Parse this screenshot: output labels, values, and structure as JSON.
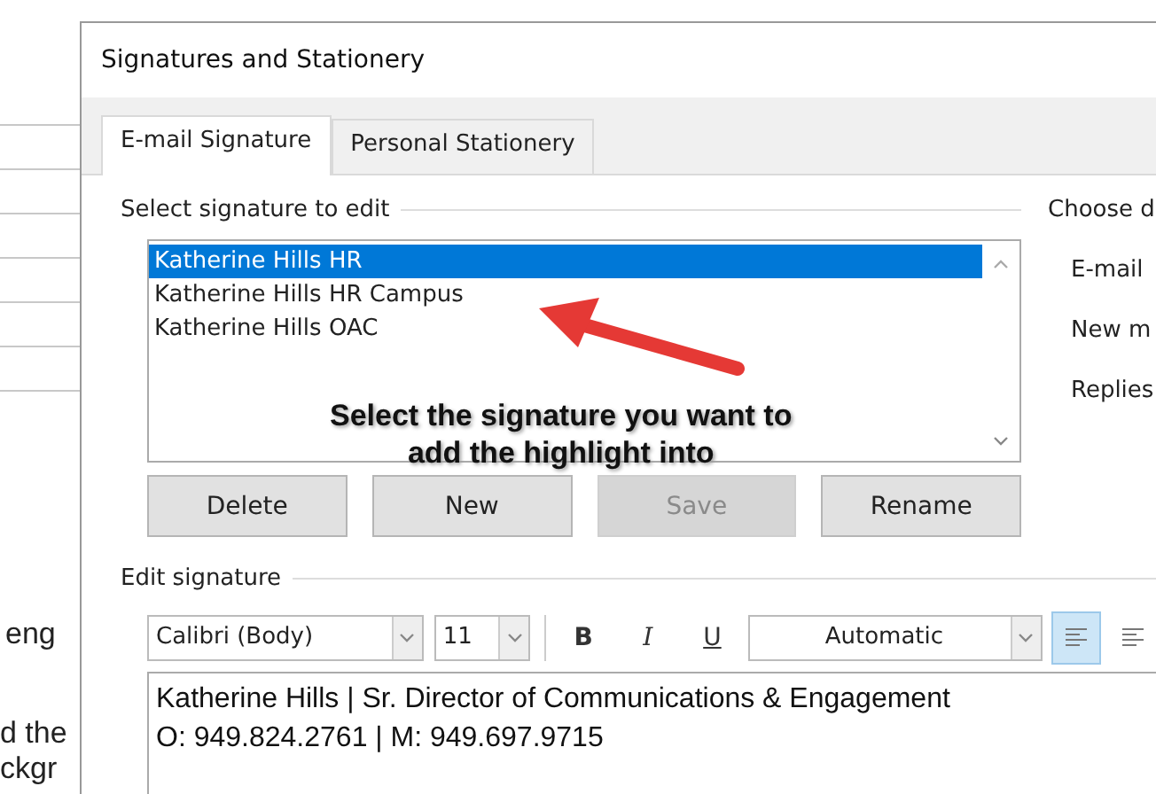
{
  "background_document": {
    "lines": [
      "eng",
      "d the",
      "ckgr"
    ]
  },
  "window": {
    "title": "Signatures and Stationery"
  },
  "tabs": [
    {
      "label": "E-mail Signature",
      "selected": true
    },
    {
      "label": "Personal Stationery",
      "selected": false
    }
  ],
  "signature_list": {
    "label": "Select signature to edit",
    "items": [
      {
        "label": "Katherine Hills HR",
        "selected": true
      },
      {
        "label": "Katherine Hills HR Campus",
        "selected": false
      },
      {
        "label": "Katherine Hills OAC",
        "selected": false
      }
    ]
  },
  "buttons": [
    {
      "label": "Delete",
      "disabled": false
    },
    {
      "label": "New",
      "disabled": false
    },
    {
      "label": "Save",
      "disabled": true
    },
    {
      "label": "Rename",
      "disabled": false
    }
  ],
  "defaults_panel": {
    "title": "Choose d",
    "labels": [
      "E-mail",
      "New m",
      "Replies"
    ]
  },
  "edit_signature": {
    "label": "Edit signature",
    "font": "Calibri (Body)",
    "size": "11",
    "format_buttons": [
      {
        "label": "B",
        "kind": "bold"
      },
      {
        "label": "I",
        "kind": "italic"
      },
      {
        "label": "U",
        "kind": "underline"
      }
    ],
    "color_setting": "Automatic",
    "alignment": [
      {
        "selected": true
      },
      {
        "selected": false
      }
    ],
    "body": [
      "Katherine Hills | Sr. Director of Communications & Engagement",
      "O: 949.824.2761 | M: 949.697.9715"
    ]
  },
  "annotation": {
    "lines": [
      "Select the signature you want to",
      "add the highlight into"
    ]
  }
}
